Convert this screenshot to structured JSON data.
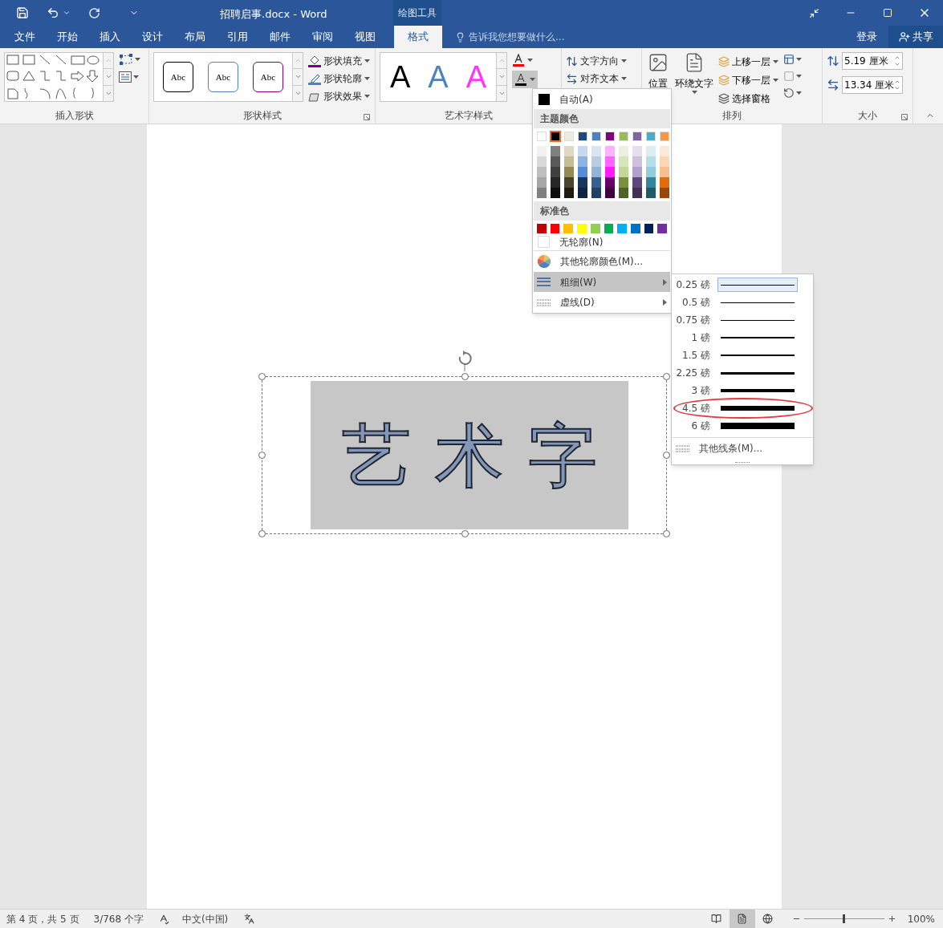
{
  "title_bar": {
    "title": "招聘启事.docx - Word",
    "context_tab": "绘图工具"
  },
  "tabs": [
    {
      "label": "文件",
      "selected": false
    },
    {
      "label": "开始",
      "selected": false
    },
    {
      "label": "插入",
      "selected": false
    },
    {
      "label": "设计",
      "selected": false
    },
    {
      "label": "布局",
      "selected": false
    },
    {
      "label": "引用",
      "selected": false
    },
    {
      "label": "邮件",
      "selected": false
    },
    {
      "label": "审阅",
      "selected": false
    },
    {
      "label": "视图",
      "selected": false
    },
    {
      "label": "格式",
      "selected": true
    }
  ],
  "search": {
    "placeholder": "告诉我您想要做什么..."
  },
  "account": "登录",
  "share": "共享",
  "ribbon": {
    "insert_shapes": {
      "label": "插入形状"
    },
    "shape_styles": {
      "presets": [
        {
          "text": "Abc",
          "color": "#000000"
        },
        {
          "text": "Abc",
          "color": "#4f81bd"
        },
        {
          "text": "Abc",
          "color": "#800080"
        }
      ],
      "commands": [
        "形状填充",
        "形状轮廓",
        "形状效果"
      ],
      "label": "形状样式"
    },
    "wordart_styles": {
      "presets": [
        {
          "text": "A",
          "color": "#000000"
        },
        {
          "text": "A",
          "color": "#4f81bd"
        },
        {
          "text": "A",
          "color": "#ff33ff"
        }
      ],
      "label": "艺术字样式"
    },
    "text": {
      "commands": [
        "文字方向",
        "对齐文本"
      ]
    },
    "arrange": {
      "position": "位置",
      "wrap": "环绕文字",
      "commands": [
        "上移一层",
        "下移一层",
        "选择窗格"
      ],
      "label": "排列"
    },
    "size": {
      "height": "5.19 厘米",
      "width": "13.34 厘米",
      "label": "大小"
    }
  },
  "document": {
    "wordart": "艺术字"
  },
  "outline_menu": {
    "auto": "自动(A)",
    "theme_header": "主题颜色",
    "theme_colors": [
      {
        "color": "#ffffff",
        "selected": false,
        "shades": [
          {
            "color": "#f2f2f2"
          },
          {
            "color": "#d9d9d9"
          },
          {
            "color": "#bfbfbf"
          },
          {
            "color": "#a6a6a6"
          },
          {
            "color": "#808080"
          }
        ]
      },
      {
        "color": "#000000",
        "selected": true,
        "shades": [
          {
            "color": "#808080"
          },
          {
            "color": "#595959"
          },
          {
            "color": "#404040"
          },
          {
            "color": "#262626"
          },
          {
            "color": "#0d0d0d"
          }
        ]
      },
      {
        "color": "#eeece1",
        "selected": false,
        "shades": [
          {
            "color": "#ddd9c4"
          },
          {
            "color": "#c4bd97"
          },
          {
            "color": "#948a54"
          },
          {
            "color": "#4a452a"
          },
          {
            "color": "#1e1c11"
          }
        ]
      },
      {
        "color": "#1f497d",
        "selected": false,
        "shades": [
          {
            "color": "#c6d9f1"
          },
          {
            "color": "#8db3e2"
          },
          {
            "color": "#548dd4"
          },
          {
            "color": "#17365d"
          },
          {
            "color": "#0f243e"
          }
        ]
      },
      {
        "color": "#4f81bd",
        "selected": false,
        "shades": [
          {
            "color": "#dbe5f1"
          },
          {
            "color": "#b8cce4"
          },
          {
            "color": "#95b3d7"
          },
          {
            "color": "#366092"
          },
          {
            "color": "#244062"
          }
        ]
      },
      {
        "color": "#800080",
        "selected": false,
        "shades": [
          {
            "color": "#ffb3ff"
          },
          {
            "color": "#ff66ff"
          },
          {
            "color": "#ff1aff"
          },
          {
            "color": "#660066"
          },
          {
            "color": "#400040"
          }
        ]
      },
      {
        "color": "#9bbb59",
        "selected": false,
        "shades": [
          {
            "color": "#ebf1de"
          },
          {
            "color": "#d8e4bc"
          },
          {
            "color": "#c4d79b"
          },
          {
            "color": "#76933c"
          },
          {
            "color": "#4f6228"
          }
        ]
      },
      {
        "color": "#8064a2",
        "selected": false,
        "shades": [
          {
            "color": "#e4dfec"
          },
          {
            "color": "#ccc0da"
          },
          {
            "color": "#b1a0c7"
          },
          {
            "color": "#60497a"
          },
          {
            "color": "#403151"
          }
        ]
      },
      {
        "color": "#4bacc6",
        "selected": false,
        "shades": [
          {
            "color": "#daeef3"
          },
          {
            "color": "#b7dee8"
          },
          {
            "color": "#92cddc"
          },
          {
            "color": "#31869b"
          },
          {
            "color": "#215967"
          }
        ]
      },
      {
        "color": "#f79646",
        "selected": false,
        "shades": [
          {
            "color": "#fde9d9"
          },
          {
            "color": "#fcd5b4"
          },
          {
            "color": "#fabf8f"
          },
          {
            "color": "#e26b0a"
          },
          {
            "color": "#974706"
          }
        ]
      }
    ],
    "standard_header": "标准色",
    "standard_colors": [
      {
        "color": "#c00000"
      },
      {
        "color": "#ff0000"
      },
      {
        "color": "#ffc000"
      },
      {
        "color": "#ffff00"
      },
      {
        "color": "#92d050"
      },
      {
        "color": "#00b050"
      },
      {
        "color": "#00b0f0"
      },
      {
        "color": "#0070c0"
      },
      {
        "color": "#002060"
      },
      {
        "color": "#7030a0"
      }
    ],
    "no_outline": "无轮廓(N)",
    "more_colors": "其他轮廓颜色(M)...",
    "submenus": [
      {
        "kind": "weight",
        "label": "粗细(W)",
        "selected": true
      },
      {
        "kind": "dash",
        "label": "虚线(D)",
        "selected": false
      }
    ]
  },
  "weight_menu": {
    "items": [
      {
        "label": "0.25 磅",
        "selected": true,
        "circled": false
      },
      {
        "label": "0.5 磅",
        "selected": false,
        "circled": false
      },
      {
        "label": "0.75 磅",
        "selected": false,
        "circled": false
      },
      {
        "label": "1 磅",
        "selected": false,
        "circled": false
      },
      {
        "label": "1.5 磅",
        "selected": false,
        "circled": false
      },
      {
        "label": "2.25 磅",
        "selected": false,
        "circled": false
      },
      {
        "label": "3 磅",
        "selected": false,
        "circled": false
      },
      {
        "label": "4.5 磅",
        "selected": false,
        "circled": true
      },
      {
        "label": "6 磅",
        "selected": false,
        "circled": false
      }
    ],
    "more": "其他线条(M)..."
  },
  "status_bar": {
    "page": "第 4 页，共 5 页",
    "words": "3/768 个字",
    "language": "中文(中国)",
    "views": [
      {
        "kind": "read",
        "selected": false
      },
      {
        "kind": "print",
        "selected": true
      },
      {
        "kind": "web",
        "selected": false
      }
    ],
    "zoom": {
      "level": 0.5,
      "reading": "100%"
    }
  }
}
